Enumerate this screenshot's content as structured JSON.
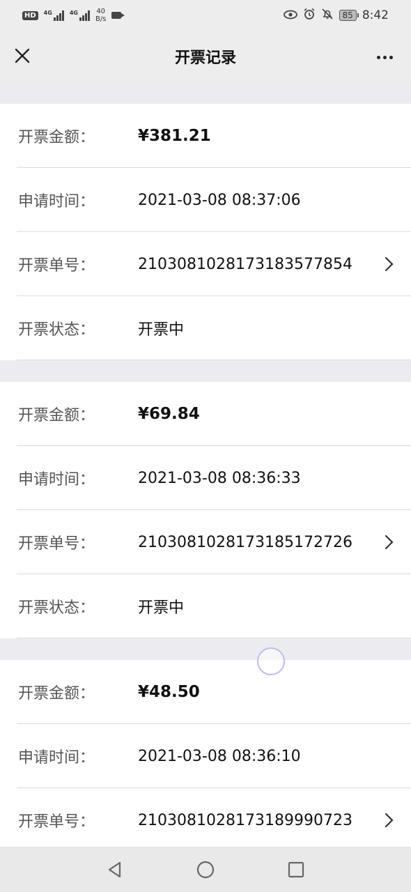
{
  "statusbar": {
    "hd": "HD",
    "net1": "4G",
    "net2": "4G",
    "speed_value": "40",
    "speed_unit": "B/s",
    "battery": "85",
    "time": "8:42"
  },
  "navbar": {
    "title": "开票记录"
  },
  "labels": {
    "amount": "开票金额：",
    "apply_time": "申请时间：",
    "order_no": "开票单号：",
    "status": "开票状态："
  },
  "records": [
    {
      "amount": "¥381.21",
      "apply_time": "2021-03-08 08:37:06",
      "order_no": "210308102817318357785 4",
      "status": "开票中"
    },
    {
      "amount": "¥69.84",
      "apply_time": "2021-03-08 08:36:33",
      "order_no": "2103081028173185172726",
      "status": "开票中"
    },
    {
      "amount": "¥48.50",
      "apply_time": "2021-03-08 08:36:10",
      "order_no": "2103081028173189990723"
    }
  ]
}
